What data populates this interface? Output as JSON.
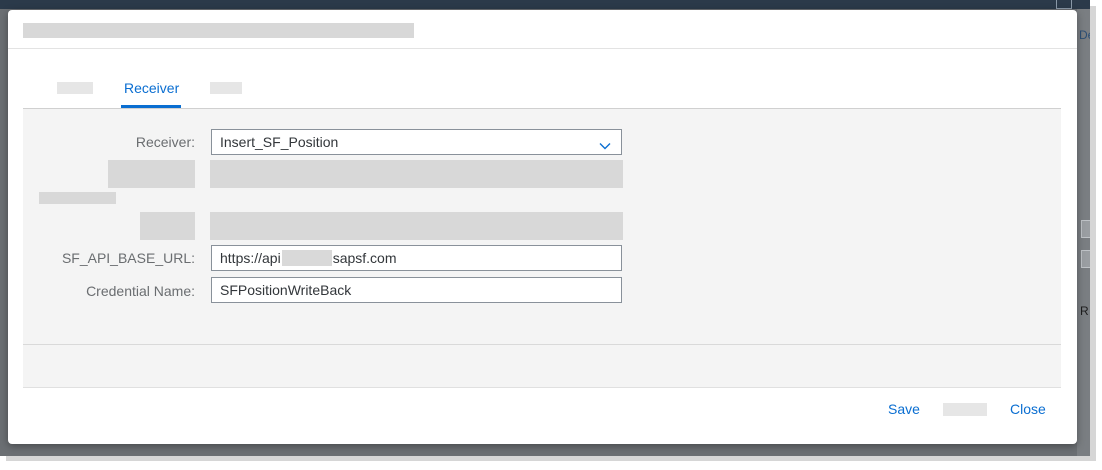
{
  "app": {
    "right_text": "De",
    "right_letter": "R"
  },
  "tabs": [
    {
      "label": ""
    },
    {
      "label": "Receiver"
    },
    {
      "label": ""
    }
  ],
  "form": {
    "receiver": {
      "label": "Receiver:",
      "value": "Insert_SF_Position"
    },
    "sf_api_base_url": {
      "label": "SF_API_BASE_URL:",
      "value_prefix": "https://api",
      "value_suffix": "sapsf.com"
    },
    "credential_name": {
      "label": "Credential Name:",
      "value": "SFPositionWriteBack"
    }
  },
  "footer": {
    "save_label": "Save",
    "close_label": "Close"
  },
  "colors": {
    "accent": "#0a6ed1",
    "content_bg": "#f4f4f4",
    "placeholder": "#d8d8d8"
  },
  "icons": {
    "receiver_dropdown": "chevron-down-icon"
  }
}
